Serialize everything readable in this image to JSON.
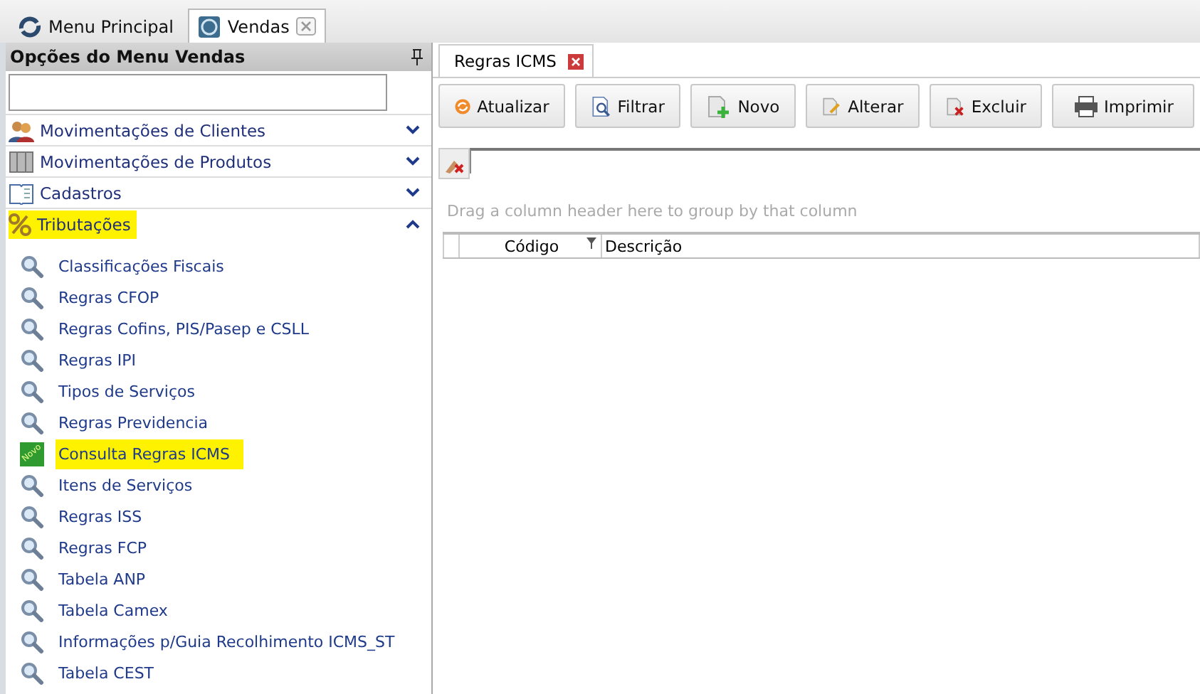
{
  "main_tabs": [
    {
      "label": "Menu Principal",
      "kind": "main",
      "selected": false,
      "closable": false
    },
    {
      "label": "Vendas",
      "kind": "sales",
      "selected": true,
      "closable": true
    }
  ],
  "sidebar": {
    "title": "Opções do Menu Vendas",
    "groups": [
      {
        "label": "Movimentações de Clientes",
        "kind": "people",
        "expanded": false,
        "highlighted": false
      },
      {
        "label": "Movimentações de Produtos",
        "kind": "boxes",
        "expanded": false,
        "highlighted": false
      },
      {
        "label": "Cadastros",
        "kind": "book",
        "expanded": false,
        "highlighted": false
      },
      {
        "label": "Tributações",
        "kind": "percent",
        "expanded": true,
        "highlighted": true
      }
    ],
    "items": [
      {
        "label": "Classificações Fiscais",
        "kind": "search",
        "highlighted": false
      },
      {
        "label": "Regras CFOP",
        "kind": "search",
        "highlighted": false
      },
      {
        "label": "Regras Cofins, PIS/Pasep e CSLL",
        "kind": "search",
        "highlighted": false
      },
      {
        "label": "Regras IPI",
        "kind": "search",
        "highlighted": false
      },
      {
        "label": "Tipos de Serviços",
        "kind": "search",
        "highlighted": false
      },
      {
        "label": "Regras Previdencia",
        "kind": "search",
        "highlighted": false
      },
      {
        "label": "Consulta Regras ICMS",
        "kind": "new",
        "badge": "Novo",
        "highlighted": true
      },
      {
        "label": "Itens de Serviços",
        "kind": "search",
        "highlighted": false
      },
      {
        "label": "Regras ISS",
        "kind": "search",
        "highlighted": false
      },
      {
        "label": "Regras FCP",
        "kind": "search",
        "highlighted": false
      },
      {
        "label": "Tabela ANP",
        "kind": "search",
        "highlighted": false
      },
      {
        "label": "Tabela Camex",
        "kind": "search",
        "highlighted": false
      },
      {
        "label": "Informações p/Guia Recolhimento ICMS_ST",
        "kind": "search",
        "highlighted": false
      },
      {
        "label": "Tabela CEST",
        "kind": "search",
        "highlighted": false
      }
    ]
  },
  "document_tab": {
    "label": "Regras ICMS"
  },
  "toolbar": [
    {
      "label": "Atualizar",
      "kind": "refresh"
    },
    {
      "label": "Filtrar",
      "kind": "filter"
    },
    {
      "label": "Novo",
      "kind": "new"
    },
    {
      "label": "Alterar",
      "kind": "edit"
    },
    {
      "label": "Excluir",
      "kind": "delete"
    },
    {
      "label": "Imprimir",
      "kind": "print"
    }
  ],
  "grid": {
    "group_hint": "Drag a column header here to group by that column",
    "columns": [
      {
        "label": "Código",
        "filter": true
      },
      {
        "label": "Descrição",
        "filter": false
      }
    ]
  }
}
